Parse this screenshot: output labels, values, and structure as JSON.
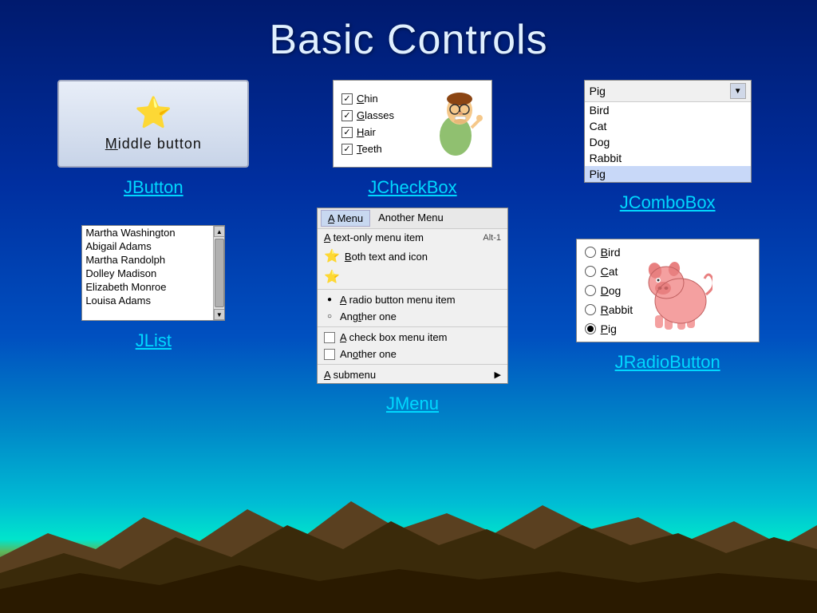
{
  "page": {
    "title": "Basic Controls"
  },
  "jbutton": {
    "label": "JButton",
    "button_text": "Middle button",
    "underline_char": "M"
  },
  "jlist": {
    "label": "JList",
    "items": [
      "Martha Washington",
      "Abigail Adams",
      "Martha Randolph",
      "Dolley Madison",
      "Elizabeth Monroe",
      "Louisa Adams"
    ]
  },
  "jcheckbox": {
    "label": "JCheckBox",
    "items": [
      {
        "text": "Chin",
        "checked": true,
        "underline": "C"
      },
      {
        "text": "Glasses",
        "checked": true,
        "underline": "G"
      },
      {
        "text": "Hair",
        "checked": true,
        "underline": "H"
      },
      {
        "text": "Teeth",
        "checked": true,
        "underline": "T"
      }
    ]
  },
  "jmenu": {
    "label": "JMenu",
    "menu_bar": [
      "A Menu",
      "Another Menu"
    ],
    "items": [
      {
        "type": "text",
        "label": "A text-only menu item",
        "shortcut": "Alt-1"
      },
      {
        "type": "icon-text",
        "label": "Both text and icon"
      },
      {
        "type": "separator"
      },
      {
        "type": "radio",
        "label": "A radio button menu item",
        "filled": true
      },
      {
        "type": "radio",
        "label": "Another one",
        "filled": false
      },
      {
        "type": "separator"
      },
      {
        "type": "checkbox",
        "label": "A check box menu item",
        "checked": false
      },
      {
        "type": "checkbox",
        "label": "Another one",
        "checked": false
      },
      {
        "type": "separator"
      },
      {
        "type": "submenu",
        "label": "A submenu"
      }
    ]
  },
  "jcombobox": {
    "label": "JComboBox",
    "selected": "Pig",
    "items": [
      "Bird",
      "Cat",
      "Dog",
      "Rabbit",
      "Pig"
    ]
  },
  "jradio": {
    "label": "JRadioButton",
    "items": [
      {
        "text": "Bird",
        "selected": false,
        "underline": "B"
      },
      {
        "text": "Cat",
        "selected": false,
        "underline": "C"
      },
      {
        "text": "Dog",
        "selected": false,
        "underline": "D"
      },
      {
        "text": "Rabbit",
        "selected": false,
        "underline": "R"
      },
      {
        "text": "Pig",
        "selected": true,
        "underline": "P"
      }
    ]
  },
  "colors": {
    "link": "#00d8ff",
    "background_top": "#001a6e",
    "background_mid": "#0050c0"
  }
}
